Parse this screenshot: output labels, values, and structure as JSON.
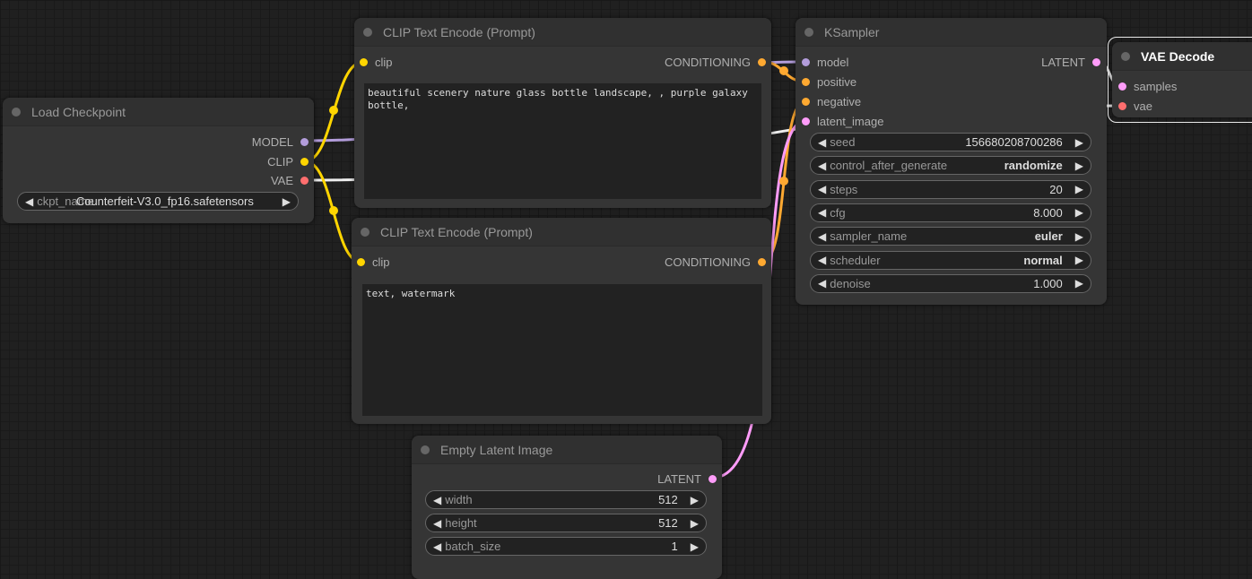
{
  "nodes": {
    "load_checkpoint": {
      "title": "Load Checkpoint",
      "outputs": [
        "MODEL",
        "CLIP",
        "VAE"
      ],
      "widget": {
        "label": "ckpt_name",
        "value": "Counterfeit-V3.0_fp16.safetensors"
      }
    },
    "clip_pos": {
      "title": "CLIP Text Encode (Prompt)",
      "input": "clip",
      "output": "CONDITIONING",
      "text": "beautiful scenery nature glass bottle landscape, , purple galaxy bottle,"
    },
    "clip_neg": {
      "title": "CLIP Text Encode (Prompt)",
      "input": "clip",
      "output": "CONDITIONING",
      "text": "text, watermark"
    },
    "ksampler": {
      "title": "KSampler",
      "inputs": [
        "model",
        "positive",
        "negative",
        "latent_image"
      ],
      "output": "LATENT",
      "widgets": [
        {
          "label": "seed",
          "value": "156680208700286"
        },
        {
          "label": "control_after_generate",
          "value": "randomize"
        },
        {
          "label": "steps",
          "value": "20"
        },
        {
          "label": "cfg",
          "value": "8.000"
        },
        {
          "label": "sampler_name",
          "value": "euler"
        },
        {
          "label": "scheduler",
          "value": "normal"
        },
        {
          "label": "denoise",
          "value": "1.000"
        }
      ]
    },
    "vae_decode": {
      "title": "VAE Decode",
      "inputs": [
        "samples",
        "vae"
      ]
    },
    "empty_latent": {
      "title": "Empty Latent Image",
      "output": "LATENT",
      "widgets": [
        {
          "label": "width",
          "value": "512"
        },
        {
          "label": "height",
          "value": "512"
        },
        {
          "label": "batch_size",
          "value": "1"
        }
      ]
    }
  },
  "colors": {
    "model": "#b39ddb",
    "clip": "#ffd500",
    "vae": "#ff6e6e",
    "conditioning": "#ffa931",
    "latent": "#ff9cf9",
    "vae_wire": "#ffffff"
  },
  "icons": {
    "left": "◀",
    "right": "▶"
  }
}
